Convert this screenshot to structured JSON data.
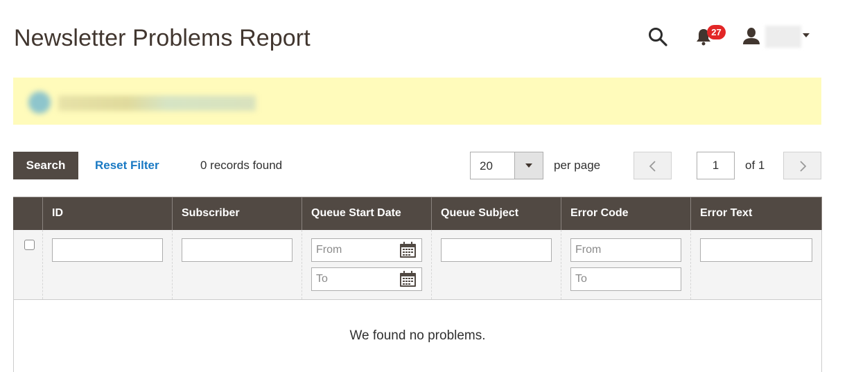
{
  "page": {
    "title": "Newsletter Problems Report"
  },
  "header": {
    "notifications_count": "27",
    "search_label": "search",
    "user_name_blurred": true
  },
  "message": {
    "text_blurred": true
  },
  "toolbar": {
    "search_label": "Search",
    "reset_label": "Reset Filter",
    "records_found": "0 records found",
    "per_page_value": "20",
    "per_page_label": "per page",
    "current_page": "1",
    "page_of": "of 1"
  },
  "grid": {
    "columns": [
      {
        "label": ""
      },
      {
        "label": "ID"
      },
      {
        "label": "Subscriber"
      },
      {
        "label": "Queue Start Date"
      },
      {
        "label": "Queue Subject"
      },
      {
        "label": "Error Code"
      },
      {
        "label": "Error Text"
      }
    ],
    "filters": {
      "id": "",
      "subscriber": "",
      "queue_start_from_placeholder": "From",
      "queue_start_to_placeholder": "To",
      "queue_subject": "",
      "error_code_from_placeholder": "From",
      "error_code_to_placeholder": "To",
      "error_text": ""
    },
    "empty_text": "We found no problems."
  },
  "icons": {
    "search": "search-icon",
    "bell": "bell-icon",
    "user": "user-icon",
    "calendar": "calendar-icon",
    "prev": "chevron-left-icon",
    "next": "chevron-right-icon"
  },
  "colors": {
    "header_bg": "#514943",
    "link": "#1979c3",
    "badge": "#e22626",
    "message_bg": "#fffbbb",
    "title": "#41362f"
  }
}
